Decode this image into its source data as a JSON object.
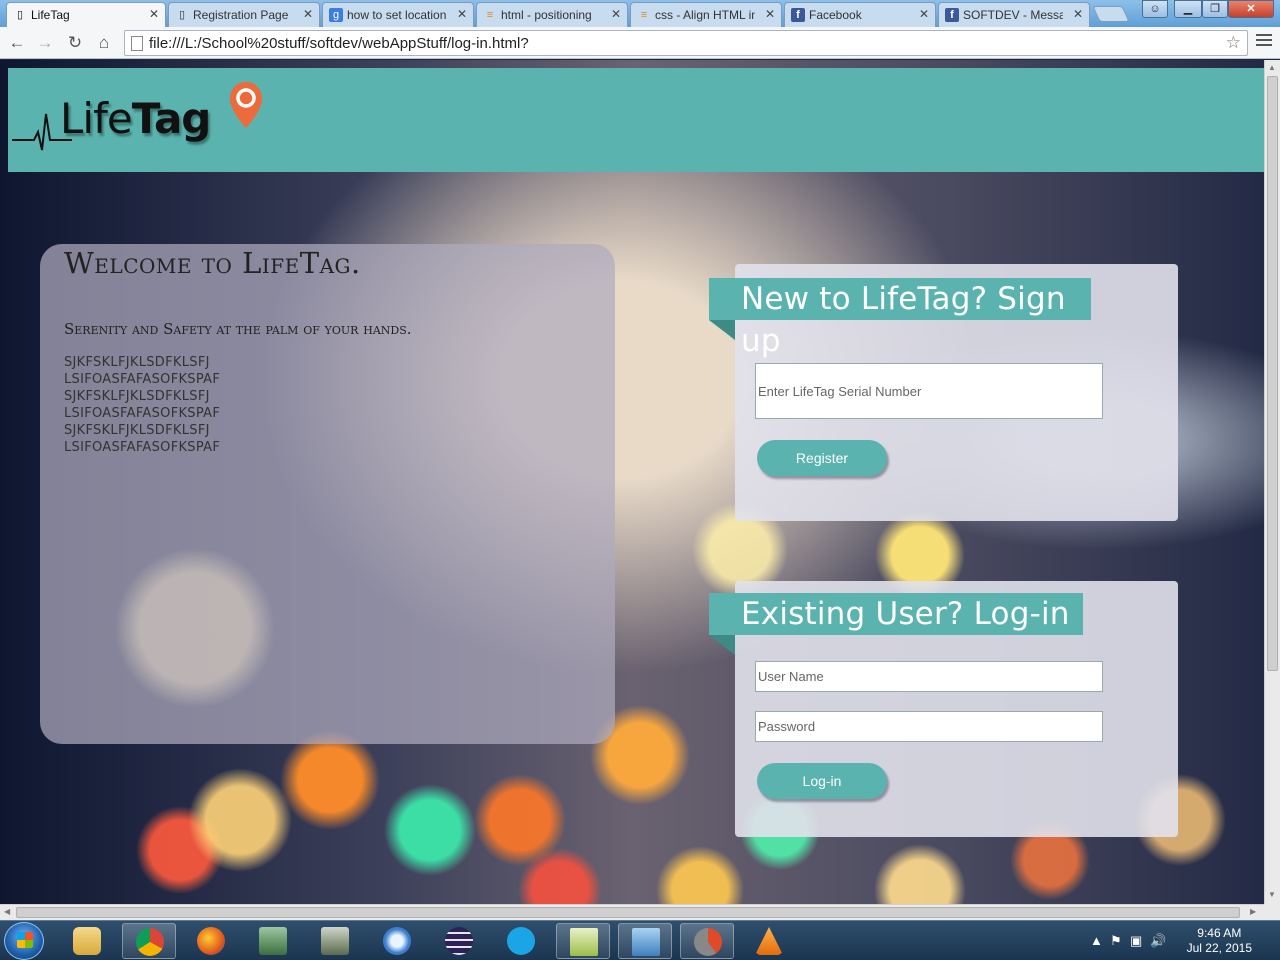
{
  "browser": {
    "tabs": [
      {
        "label": "LifeTag",
        "icon": "page-icon",
        "active": true
      },
      {
        "label": "Registration Page",
        "icon": "page-icon",
        "active": false
      },
      {
        "label": "how to set location",
        "icon": "google-icon",
        "active": false
      },
      {
        "label": "html - positioning",
        "icon": "stackoverflow-icon",
        "active": false
      },
      {
        "label": "css - Align HTML in",
        "icon": "stackoverflow-icon",
        "active": false
      },
      {
        "label": "Facebook",
        "icon": "facebook-icon",
        "active": false
      },
      {
        "label": "SOFTDEV - Messag",
        "icon": "facebook-icon",
        "active": false
      }
    ],
    "url": "file:///L:/School%20stuff/softdev/webAppStuff/log-in.html?"
  },
  "header": {
    "logo_text_light": "Life",
    "logo_text_bold": "Tag",
    "color": "#5ab3ae"
  },
  "welcome": {
    "title": "Welcome to LifeTag.",
    "subtitle": "Serenity and Safety at the palm of your hands.",
    "lines": [
      "SJKFSKLFJKLSDFKLSFJ",
      "LSIFOASFAFASOFKSPAF",
      "SJKFSKLFJKLSDFKLSFJ",
      "LSIFOASFAFASOFKSPAF",
      "SJKFSKLFJKLSDFKLSFJ",
      "LSIFOASFAFASOFKSPAF"
    ]
  },
  "signup": {
    "heading": "New to LifeTag? Sign up",
    "serial_placeholder": "Enter LifeTag Serial Number",
    "register_label": "Register"
  },
  "login": {
    "heading": "Existing User? Log-in",
    "username_placeholder": "User Name",
    "password_placeholder": "Password",
    "login_label": "Log-in"
  },
  "taskbar": {
    "time": "9:46 AM",
    "date": "Jul 22, 2015"
  }
}
